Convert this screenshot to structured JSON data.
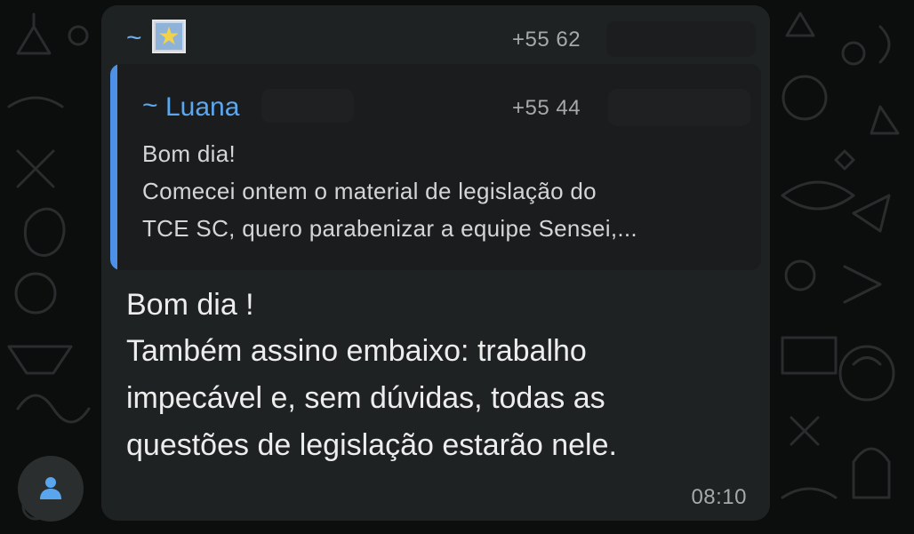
{
  "sender": {
    "prefix": "~",
    "avatar_icon": "star-avatar-icon",
    "phone": "+55 62"
  },
  "quoted": {
    "prefix": "~",
    "name": "Luana",
    "phone": "+55 44",
    "lines": [
      "Bom dia!",
      "Comecei ontem o material de legislação do",
      "TCE SC, quero parabenizar a equipe Sensei,..."
    ]
  },
  "message": {
    "lines": [
      "Bom dia !",
      "Também assino embaixo: trabalho",
      "impecável e, sem dúvidas, todas as",
      "questões de legislação estarão nele."
    ],
    "time": "08:10"
  },
  "colors": {
    "background": "#0c0d0d",
    "bubble": "#1f2223",
    "quote_bar": "#4d90e8",
    "name_accent": "#5ba8f0"
  }
}
